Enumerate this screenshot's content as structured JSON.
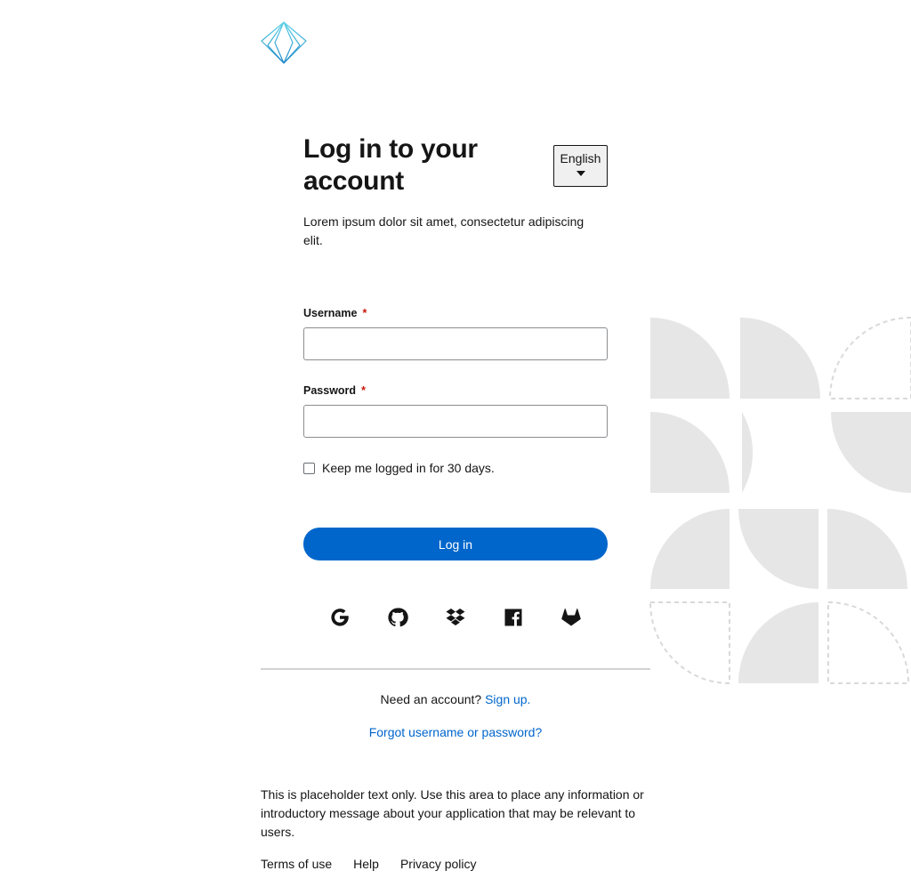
{
  "heading": "Log in to your account",
  "language": {
    "selected": "English"
  },
  "subtitle": "Lorem ipsum dolor sit amet, consectetur adipiscing elit.",
  "form": {
    "username_label": "Username",
    "password_label": "Password",
    "required_marker": "*",
    "username_value": "",
    "password_value": "",
    "remember_label": "Keep me logged in for 30 days.",
    "remember_checked": false,
    "login_button": "Log in"
  },
  "social_logins": [
    {
      "icon": "google-icon"
    },
    {
      "icon": "github-icon"
    },
    {
      "icon": "dropbox-icon"
    },
    {
      "icon": "facebook-icon"
    },
    {
      "icon": "gitlab-icon"
    }
  ],
  "signup": {
    "prompt": "Need an account?",
    "link": "Sign up."
  },
  "forgot_link": "Forgot username or password?",
  "placeholder_text": "This is placeholder text only. Use this area to place any information or introductory message about your application that may be relevant to users.",
  "footer": {
    "terms": "Terms of use",
    "help": "Help",
    "privacy": "Privacy policy"
  },
  "colors": {
    "primary": "#0066cc",
    "required": "#c9190b",
    "divider": "#d2d2d2",
    "background_art": "#e5e5e5"
  }
}
